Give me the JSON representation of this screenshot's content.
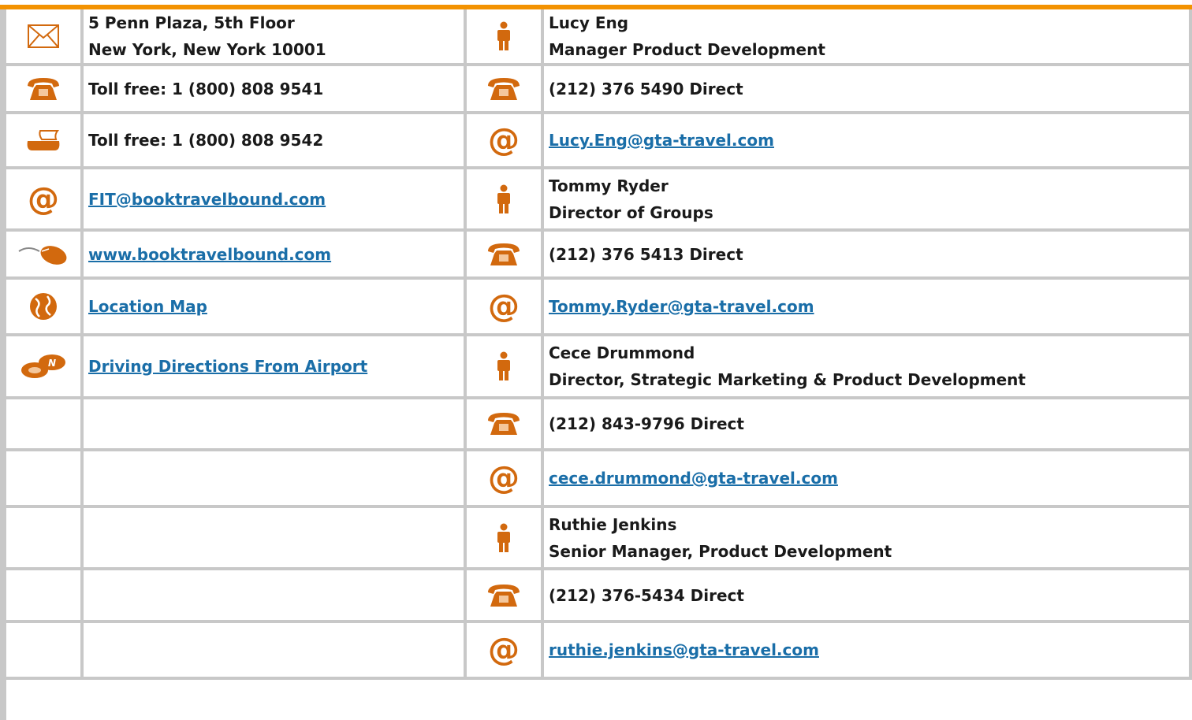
{
  "colors": {
    "accent": "#f39200",
    "icon": "#d2690e",
    "link": "#1a6ea8",
    "grid": "#c8c8c8"
  },
  "rows": [
    {
      "left": {
        "icon": "envelope-icon",
        "lines": [
          "5 Penn Plaza, 5th Floor",
          "New York, New York 10001"
        ]
      },
      "right": {
        "icon": "person-icon",
        "lines": [
          "Lucy Eng",
          "Manager Product Development"
        ]
      }
    },
    {
      "left": {
        "icon": "phone-icon",
        "text": "Toll free: 1 (800) 808 9541"
      },
      "right": {
        "icon": "phone-icon",
        "text": "(212) 376 5490 Direct"
      }
    },
    {
      "left": {
        "icon": "fax-icon",
        "text": "Toll free: 1 (800) 808 9542"
      },
      "right": {
        "icon": "email-icon",
        "link": "Lucy.Eng@gta-travel.com"
      }
    },
    {
      "left": {
        "icon": "email-icon",
        "link": "FIT@booktravelbound.com"
      },
      "right": {
        "icon": "person-icon",
        "lines": [
          "Tommy Ryder",
          "Director of Groups"
        ]
      }
    },
    {
      "left": {
        "icon": "mouse-icon",
        "link": "www.booktravelbound.com"
      },
      "right": {
        "icon": "phone-icon",
        "text": "(212) 376 5413 Direct"
      }
    },
    {
      "left": {
        "icon": "globe-icon",
        "link": "Location Map"
      },
      "right": {
        "icon": "email-icon",
        "link": "Tommy.Ryder@gta-travel.com"
      }
    },
    {
      "left": {
        "icon": "compass-icon",
        "link": "Driving Directions From Airport"
      },
      "right": {
        "icon": "person-icon",
        "lines": [
          "Cece Drummond",
          "Director, Strategic Marketing & Product Development"
        ]
      }
    },
    {
      "right": {
        "icon": "phone-icon",
        "text": "(212) 843-9796 Direct"
      }
    },
    {
      "right": {
        "icon": "email-icon",
        "link": "cece.drummond@gta-travel.com"
      }
    },
    {
      "right": {
        "icon": "person-icon",
        "lines": [
          "Ruthie Jenkins",
          "Senior Manager, Product Development"
        ]
      }
    },
    {
      "right": {
        "icon": "phone-icon",
        "text": "(212) 376-5434 Direct"
      }
    },
    {
      "right": {
        "icon": "email-icon",
        "link": "ruthie.jenkins@gta-travel.com"
      }
    }
  ]
}
